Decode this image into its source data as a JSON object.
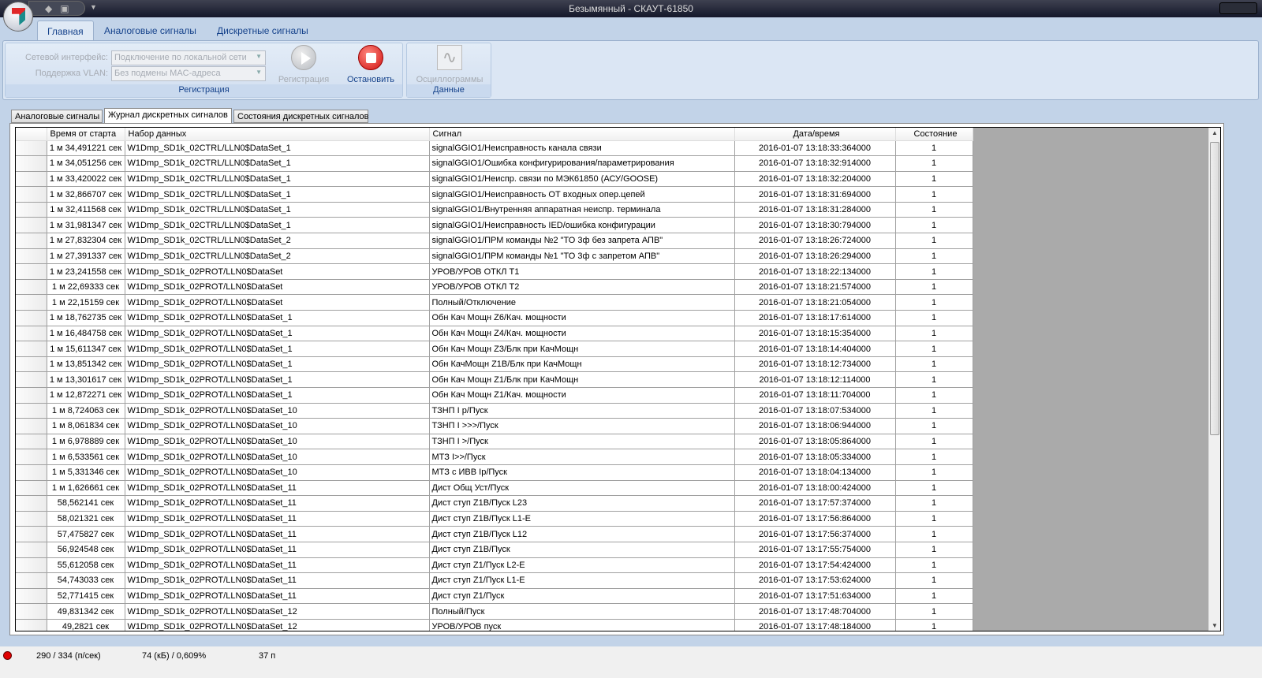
{
  "window": {
    "title": "Безымянный - СКАУТ-61850"
  },
  "ribbon_tabs": [
    "Главная",
    "Аналоговые сигналы",
    "Дискретные сигналы"
  ],
  "registration_group": {
    "label": "Регистрация",
    "network_label": "Сетевой интерфейс:",
    "network_value": "Подключение по локальной сети",
    "vlan_label": "Поддержка VLAN:",
    "vlan_value": "Без подмены MAC-адреса",
    "start_label": "Регистрация",
    "stop_label": "Остановить"
  },
  "data_group": {
    "label": "Данные",
    "osc_label": "Осциллограммы"
  },
  "doc_tabs": [
    "Аналоговые сигналы",
    "Журнал дискретных сигналов",
    "Состояния дискретных сигналов"
  ],
  "table": {
    "headers": [
      "Время от старта",
      "Набор данных",
      "Сигнал",
      "Дата/время",
      "Состояние"
    ],
    "rows": [
      [
        "1 м 34,491221 сек",
        "W1Dmp_SD1k_02CTRL/LLN0$DataSet_1",
        "signalGGIO1/Неисправность канала связи",
        "2016-01-07   13:18:33:364000",
        "1"
      ],
      [
        "1 м 34,051256 сек",
        "W1Dmp_SD1k_02CTRL/LLN0$DataSet_1",
        "signalGGIO1/Ошибка конфигурирования/параметрирования",
        "2016-01-07   13:18:32:914000",
        "1"
      ],
      [
        "1 м 33,420022 сек",
        "W1Dmp_SD1k_02CTRL/LLN0$DataSet_1",
        "signalGGIO1/Неиспр. связи по МЭК61850 (АСУ/GOOSE)",
        "2016-01-07   13:18:32:204000",
        "1"
      ],
      [
        "1 м 32,866707 сек",
        "W1Dmp_SD1k_02CTRL/LLN0$DataSet_1",
        "signalGGIO1/Неисправность ОТ входных опер.цепей",
        "2016-01-07   13:18:31:694000",
        "1"
      ],
      [
        "1 м 32,411568 сек",
        "W1Dmp_SD1k_02CTRL/LLN0$DataSet_1",
        "signalGGIO1/Внутренняя аппаратная неиспр. терминала",
        "2016-01-07   13:18:31:284000",
        "1"
      ],
      [
        "1 м 31,981347 сек",
        "W1Dmp_SD1k_02CTRL/LLN0$DataSet_1",
        "signalGGIO1/Неисправность IED/ошибка конфигурации",
        "2016-01-07   13:18:30:794000",
        "1"
      ],
      [
        "1 м 27,832304 сек",
        "W1Dmp_SD1k_02CTRL/LLN0$DataSet_2",
        "signalGGIO1/ПРМ команды №2 \"ТО 3ф без запрета АПВ\"",
        "2016-01-07   13:18:26:724000",
        "1"
      ],
      [
        "1 м 27,391337 сек",
        "W1Dmp_SD1k_02CTRL/LLN0$DataSet_2",
        "signalGGIO1/ПРМ команды №1 \"ТО 3ф с запретом АПВ\"",
        "2016-01-07   13:18:26:294000",
        "1"
      ],
      [
        "1 м 23,241558 сек",
        "W1Dmp_SD1k_02PROT/LLN0$DataSet",
        "УРОВ/УРОВ ОТКЛ Т1",
        "2016-01-07   13:18:22:134000",
        "1"
      ],
      [
        "1 м 22,69333 сек",
        "W1Dmp_SD1k_02PROT/LLN0$DataSet",
        "УРОВ/УРОВ ОТКЛ Т2",
        "2016-01-07   13:18:21:574000",
        "1"
      ],
      [
        "1 м 22,15159 сек",
        "W1Dmp_SD1k_02PROT/LLN0$DataSet",
        "Полный/Отключение",
        "2016-01-07   13:18:21:054000",
        "1"
      ],
      [
        "1 м 18,762735 сек",
        "W1Dmp_SD1k_02PROT/LLN0$DataSet_1",
        "Обн Кач Мощн Z6/Кач. мощности",
        "2016-01-07   13:18:17:614000",
        "1"
      ],
      [
        "1 м 16,484758 сек",
        "W1Dmp_SD1k_02PROT/LLN0$DataSet_1",
        "Обн Кач Мощн Z4/Кач. мощности",
        "2016-01-07   13:18:15:354000",
        "1"
      ],
      [
        "1 м 15,611347 сек",
        "W1Dmp_SD1k_02PROT/LLN0$DataSet_1",
        "Обн Кач Мощн Z3/Блк при КачМощн",
        "2016-01-07   13:18:14:404000",
        "1"
      ],
      [
        "1 м 13,851342 сек",
        "W1Dmp_SD1k_02PROT/LLN0$DataSet_1",
        "Обн КачМощн Z1B/Блк при КачМощн",
        "2016-01-07   13:18:12:734000",
        "1"
      ],
      [
        "1 м 13,301617 сек",
        "W1Dmp_SD1k_02PROT/LLN0$DataSet_1",
        "Обн Кач Мощн Z1/Блк при КачМощн",
        "2016-01-07   13:18:12:114000",
        "1"
      ],
      [
        "1 м 12,872271 сек",
        "W1Dmp_SD1k_02PROT/LLN0$DataSet_1",
        "Обн Кач Мощн Z1/Кач. мощности",
        "2016-01-07   13:18:11:704000",
        "1"
      ],
      [
        "1 м 8,724063 сек",
        "W1Dmp_SD1k_02PROT/LLN0$DataSet_10",
        "ТЗНП I р/Пуск",
        "2016-01-07   13:18:07:534000",
        "1"
      ],
      [
        "1 м 8,061834 сек",
        "W1Dmp_SD1k_02PROT/LLN0$DataSet_10",
        "ТЗНП I >>>/Пуск",
        "2016-01-07   13:18:06:944000",
        "1"
      ],
      [
        "1 м 6,978889 сек",
        "W1Dmp_SD1k_02PROT/LLN0$DataSet_10",
        "ТЗНП I >/Пуск",
        "2016-01-07   13:18:05:864000",
        "1"
      ],
      [
        "1 м 6,533561 сек",
        "W1Dmp_SD1k_02PROT/LLN0$DataSet_10",
        "МТЗ I>>/Пуск",
        "2016-01-07   13:18:05:334000",
        "1"
      ],
      [
        "1 м 5,331346 сек",
        "W1Dmp_SD1k_02PROT/LLN0$DataSet_10",
        "МТЗ с ИВВ Ip/Пуск",
        "2016-01-07   13:18:04:134000",
        "1"
      ],
      [
        "1 м 1,626661 сек",
        "W1Dmp_SD1k_02PROT/LLN0$DataSet_11",
        "Дист Общ Уст/Пуск",
        "2016-01-07   13:18:00:424000",
        "1"
      ],
      [
        "58,562141 сек",
        "W1Dmp_SD1k_02PROT/LLN0$DataSet_11",
        "Дист ступ Z1B/Пуск L23",
        "2016-01-07   13:17:57:374000",
        "1"
      ],
      [
        "58,021321 сек",
        "W1Dmp_SD1k_02PROT/LLN0$DataSet_11",
        "Дист ступ Z1B/Пуск L1-E",
        "2016-01-07   13:17:56:864000",
        "1"
      ],
      [
        "57,475827 сек",
        "W1Dmp_SD1k_02PROT/LLN0$DataSet_11",
        "Дист ступ Z1B/Пуск L12",
        "2016-01-07   13:17:56:374000",
        "1"
      ],
      [
        "56,924548 сек",
        "W1Dmp_SD1k_02PROT/LLN0$DataSet_11",
        "Дист ступ Z1B/Пуск",
        "2016-01-07   13:17:55:754000",
        "1"
      ],
      [
        "55,612058 сек",
        "W1Dmp_SD1k_02PROT/LLN0$DataSet_11",
        "Дист ступ Z1/Пуск L2-E",
        "2016-01-07   13:17:54:424000",
        "1"
      ],
      [
        "54,743033 сек",
        "W1Dmp_SD1k_02PROT/LLN0$DataSet_11",
        "Дист ступ Z1/Пуск L1-E",
        "2016-01-07   13:17:53:624000",
        "1"
      ],
      [
        "52,771415 сек",
        "W1Dmp_SD1k_02PROT/LLN0$DataSet_11",
        "Дист ступ Z1/Пуск",
        "2016-01-07   13:17:51:634000",
        "1"
      ],
      [
        "49,831342 сек",
        "W1Dmp_SD1k_02PROT/LLN0$DataSet_12",
        "Полный/Пуск",
        "2016-01-07   13:17:48:704000",
        "1"
      ],
      [
        "49,2821 сек",
        "W1Dmp_SD1k_02PROT/LLN0$DataSet_12",
        "УРОВ/УРОВ пуск",
        "2016-01-07   13:17:48:184000",
        "1"
      ]
    ]
  },
  "status": {
    "rate": "290 / 334 (п/сек)",
    "size": "74 (кБ) / 0,609%",
    "count": "37 п",
    "indicator_color": "#e00000"
  }
}
